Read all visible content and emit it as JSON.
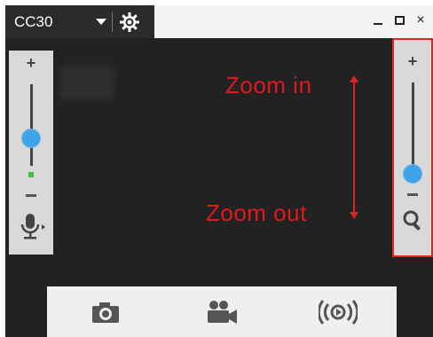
{
  "titlebar": {
    "camera_name": "CC30",
    "settings_icon": "gear-icon",
    "minimize_icon": "minimize-icon",
    "maximize_icon": "maximize-icon",
    "close_icon": "close-icon",
    "close_label": "×"
  },
  "left_panel": {
    "zoom_in_label": "+",
    "zoom_out_icon": "minus-icon",
    "slider_level": 0.6,
    "mic_icon": "microphone-icon",
    "mic_expand_icon": "caret-right-icon",
    "mic_level_indicator": "green"
  },
  "right_panel": {
    "zoom_in_label": "+",
    "zoom_out_icon": "minus-icon",
    "slider_level": 0.25,
    "search_icon": "magnifier-icon",
    "highlight_color": "#d92525"
  },
  "annotations": {
    "zoom_in": "Zoom in",
    "zoom_out": "Zoom out",
    "color": "#e0191e"
  },
  "toolbar": {
    "items": [
      {
        "icon": "camera-icon"
      },
      {
        "icon": "video-camera-icon"
      },
      {
        "icon": "broadcast-icon"
      }
    ]
  },
  "colors": {
    "video_bg": "#222222",
    "panel_bg": "#d9d9d9",
    "knob": "#3ea3e8"
  }
}
